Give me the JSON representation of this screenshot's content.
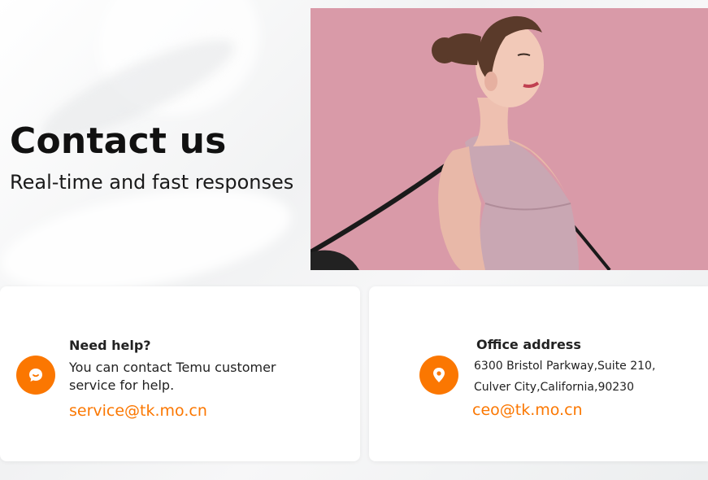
{
  "hero": {
    "title": "Contact us",
    "subtitle": "Real-time and fast responses"
  },
  "help_card": {
    "icon": "chat-bubble-icon",
    "heading": "Need help?",
    "text_line1": "You can contact Temu customer",
    "text_line2": "service for help.",
    "email": "service@tk.mo.cn"
  },
  "office_card": {
    "icon": "location-pin-icon",
    "heading": "Office address",
    "address_line1": "6300 Bristol Parkway,Suite 210,",
    "address_line2": "Culver City,California,90230",
    "email": "ceo@tk.mo.cn"
  },
  "colors": {
    "accent": "#fb7701",
    "photo_background": "#d99aa8"
  }
}
